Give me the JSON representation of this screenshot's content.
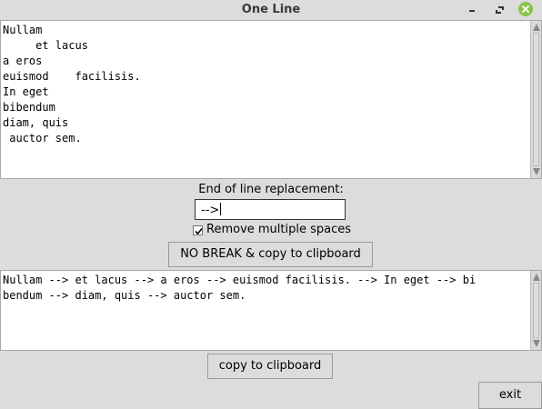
{
  "window": {
    "title": "One Line"
  },
  "input_text": {
    "content": "Nullam\n     et lacus\na eros\neuismod    facilisis.\nIn eget\nbibendum\ndiam, quis\n auctor sem."
  },
  "replacement": {
    "label": "End of line replacement:",
    "value": "-->"
  },
  "remove_spaces": {
    "label": "Remove multiple spaces",
    "checked": true
  },
  "nobreak_button": {
    "label": "NO BREAK & copy to clipboard"
  },
  "output_text": {
    "content": "Nullam --> et lacus --> a eros --> euismod facilisis. --> In eget --> bi\nbendum --> diam, quis --> auctor sem."
  },
  "copy_button": {
    "label": "copy to clipboard"
  },
  "exit_button": {
    "label": "exit"
  },
  "icons": {
    "minimize": "minimize-icon",
    "maximize": "maximize-icon",
    "close": "close-icon",
    "checkmark": "checkmark-icon"
  },
  "colors": {
    "close_button": "#8bc34a",
    "window_bg": "#dcdcdc"
  }
}
